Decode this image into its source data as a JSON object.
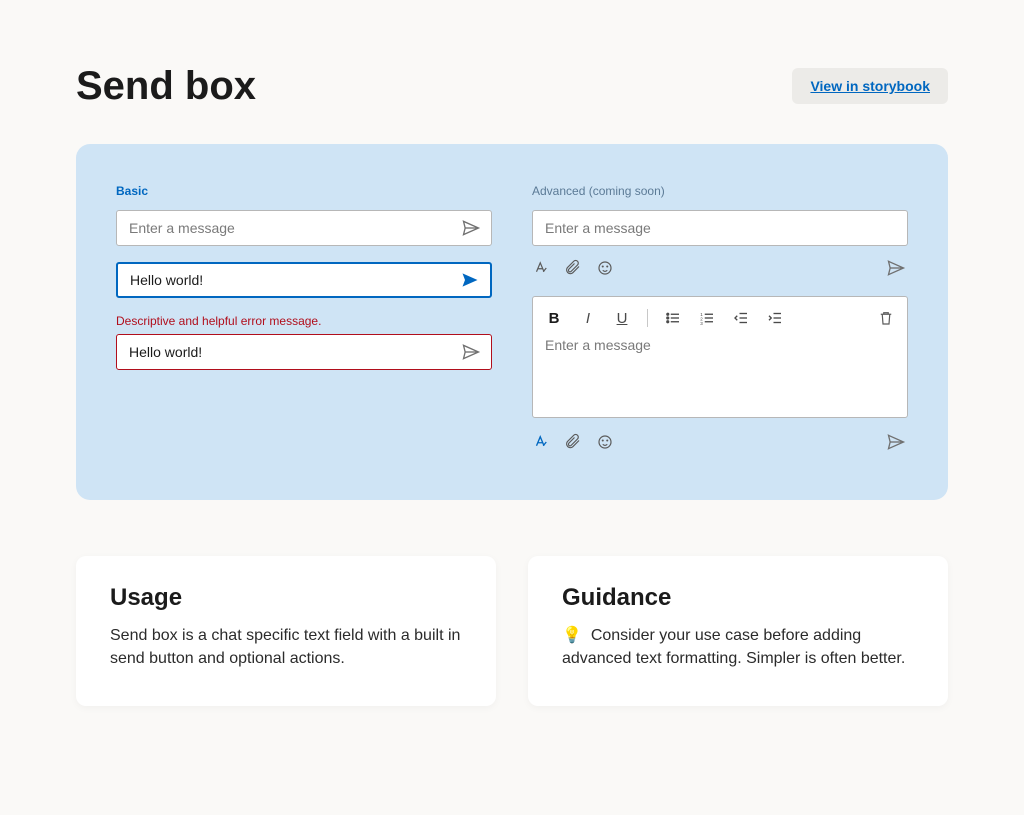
{
  "header": {
    "title": "Send box",
    "storybook_label": "View in storybook"
  },
  "showcase": {
    "basic": {
      "label": "Basic",
      "placeholder": "Enter a message",
      "focus_value": "Hello world!",
      "error_message": "Descriptive and helpful error message.",
      "error_value": "Hello world!"
    },
    "advanced": {
      "label": "Advanced (coming soon)",
      "placeholder": "Enter a message",
      "rich_placeholder": "Enter a message"
    }
  },
  "cards": {
    "usage": {
      "title": "Usage",
      "body": "Send box is a chat specific text field with a built in send button and optional actions."
    },
    "guidance": {
      "title": "Guidance",
      "body": "Consider your use case before adding advanced text formatting. Simpler is often better."
    }
  }
}
